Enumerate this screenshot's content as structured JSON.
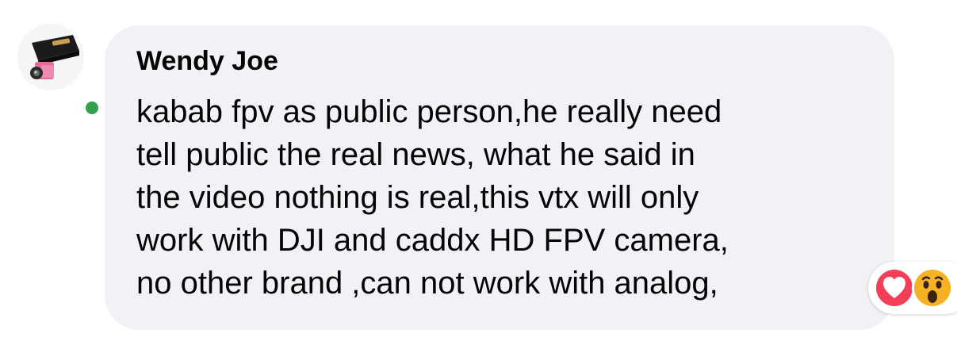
{
  "comment": {
    "author": "Wendy Joe",
    "text_lines": [
      "kabab fpv as public person,he really need",
      "tell public the real news, what he said in",
      "the video nothing is real,this vtx will only",
      "work with DJI and caddx HD FPV camera,",
      "no other brand ,can not work with analog,"
    ],
    "presence_status": "online",
    "reactions": [
      "love",
      "wow"
    ]
  },
  "colors": {
    "bubble": "#f0f2f5",
    "text": "#050505",
    "presence": "#31a24c",
    "love": "#f33e58",
    "wow": "#f7b125"
  },
  "icons": {
    "avatar": "caddx-product-avatar",
    "love": "heart-reaction-icon",
    "wow": "wow-reaction-icon"
  }
}
